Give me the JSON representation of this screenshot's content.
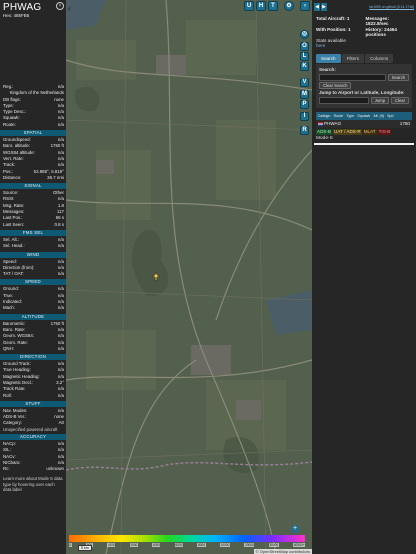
{
  "aircraft": {
    "callsign": "PHWAG",
    "hex_label": "Hex: 485FB5"
  },
  "left_panel": {
    "info_rows": [
      {
        "k": "Reg.:",
        "v": "n/a"
      },
      {
        "k": "",
        "v": "Kingdom of the Netherlands"
      },
      {
        "k": "DB flags:",
        "v": "none"
      },
      {
        "k": "Type:",
        "v": "n/a"
      },
      {
        "k": "",
        "v": ""
      },
      {
        "k": "Type Desc.:",
        "v": "n/a"
      },
      {
        "k": "Squawk:",
        "v": "n/a"
      },
      {
        "k": "Route:",
        "v": "n/a"
      }
    ],
    "sections": [
      {
        "title": "SPATIAL",
        "rows": [
          {
            "k": "Groundspeed:",
            "v": "n/a"
          },
          {
            "k": "Baro. altitude:",
            "v": "1750 ft"
          },
          {
            "k": "WGS84 altitude:",
            "v": "n/a"
          },
          {
            "k": "Vert. Rate:",
            "v": "n/a"
          },
          {
            "k": "Track:",
            "v": "n/a"
          },
          {
            "k": "Pos.:",
            "v": "52.885°, 6.819°"
          },
          {
            "k": "Distance:",
            "v": "36.7 nmi"
          }
        ]
      },
      {
        "title": "SIGNAL",
        "rows": [
          {
            "k": "Source:",
            "v": "Other"
          },
          {
            "k": "RSSI:",
            "v": "n/a"
          },
          {
            "k": "Msg. Rate:",
            "v": "1.8"
          },
          {
            "k": "Messages:",
            "v": "117"
          },
          {
            "k": "Last Pos.:",
            "v": "56 s"
          },
          {
            "k": "Last Seen:",
            "v": "0.8 s"
          }
        ]
      },
      {
        "title": "FMS SEL",
        "rows": [
          {
            "k": "Sel. Alt.:",
            "v": "n/a"
          },
          {
            "k": "Sel. Head.:",
            "v": "n/a"
          }
        ]
      },
      {
        "title": "WIND",
        "rows": [
          {
            "k": "Speed:",
            "v": "n/a"
          },
          {
            "k": "Direction (from):",
            "v": "n/a"
          },
          {
            "k": "TAT / OAT:",
            "v": "n/a"
          }
        ]
      },
      {
        "title": "SPEED",
        "rows": [
          {
            "k": "Ground:",
            "v": "n/a"
          },
          {
            "k": "True:",
            "v": "n/a"
          },
          {
            "k": "Indicated:",
            "v": "n/a"
          },
          {
            "k": "Mach:",
            "v": "n/a"
          }
        ]
      },
      {
        "title": "ALTITUDE",
        "rows": [
          {
            "k": "Barometric:",
            "v": "1750 ft"
          },
          {
            "k": "Baro. Rate:",
            "v": "n/a"
          },
          {
            "k": "Geom. WGS84:",
            "v": "n/a"
          },
          {
            "k": "Geom. Rate:",
            "v": "n/a"
          },
          {
            "k": "QNH:",
            "v": "n/a"
          }
        ]
      },
      {
        "title": "DIRECTION",
        "rows": [
          {
            "k": "Ground Track:",
            "v": "n/a"
          },
          {
            "k": "True Heading:",
            "v": "n/a"
          },
          {
            "k": "Magnetic Heading:",
            "v": "n/a"
          },
          {
            "k": "Magnetic Decl.:",
            "v": "3.2°"
          },
          {
            "k": "Track Rate:",
            "v": "n/a"
          },
          {
            "k": "Roll:",
            "v": "n/a"
          }
        ]
      },
      {
        "title": "STUFF",
        "rows": [
          {
            "k": "Nav. Modes:",
            "v": "n/a"
          },
          {
            "k": "ADS-B Ver.:",
            "v": "none"
          },
          {
            "k": "Category:",
            "v": "A0"
          }
        ]
      }
    ],
    "category_desc": "Unspecified powered aircraft",
    "accuracy": {
      "title": "ACCURACY",
      "rows": [
        {
          "k": "NACp:",
          "v": "n/a"
        },
        {
          "k": "SIL:",
          "v": "n/a"
        },
        {
          "k": "NACv:",
          "v": "n/a"
        },
        {
          "k": "NICbaro:",
          "v": "n/a"
        },
        {
          "k": "Rc:",
          "v": "unknown"
        }
      ]
    },
    "footer_note": "Learn more about Mode S data type by hovering over each data label"
  },
  "map": {
    "top_buttons": [
      "U",
      "H",
      "T"
    ],
    "side_buttons": [
      "O",
      "L",
      "K",
      "V",
      "M",
      "P",
      "I",
      "R"
    ],
    "zoom_in": "+",
    "zoom_out": "−",
    "attribution": "© OpenStreetMap contributors",
    "scale_label": "5 km",
    "altitude_labels": [
      "0",
      "500",
      "1000",
      "2000",
      "4000",
      "6000",
      "8000",
      "10000",
      "20000",
      "30000",
      "40000+"
    ],
    "colors": {
      "land": "#55604f",
      "roads": "#7a7a6a",
      "water": "#4c5f6a",
      "track": "#f2c74c"
    }
  },
  "right_panel": {
    "link_text": "tar1090 on github (3.14.1718)",
    "stats": [
      {
        "label": "Total Aircraft: 1",
        "value": "Messages: 1822.8/sec",
        "label_bold": true
      },
      {
        "label": "With Position: 1",
        "value": "History: 24464 positions"
      },
      {
        "label": "Stats available",
        "value": ""
      },
      {
        "label": "here",
        "value": ""
      }
    ],
    "tabs": [
      "Search",
      "Filters",
      "Columns"
    ],
    "search": {
      "label": "Search:",
      "placeholder": "",
      "search_btn": "Search",
      "clear_btn": "Clear Search",
      "jump_label": "Jump to Airport or Latitude, Longitude:",
      "jump_btn": "Jump",
      "jump_clear_btn": "Clear"
    },
    "table_headers": [
      "Callsign",
      "Route",
      "Type",
      "Squawk",
      "Alt. (ft)",
      "Spd"
    ],
    "table_row": {
      "callsign": "PHWAG",
      "altitude": "1750"
    },
    "badges": [
      "ADS-B",
      "UAT / ADS-R",
      "MLAT",
      "TIS-B"
    ],
    "modes_label": "Mode-S"
  }
}
